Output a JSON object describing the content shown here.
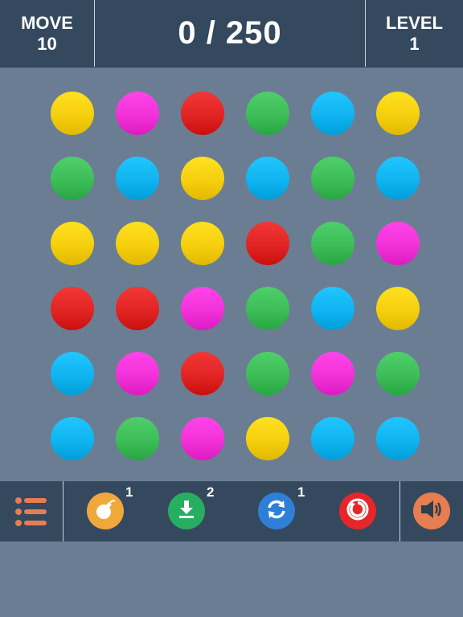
{
  "header": {
    "move_label": "MOVE",
    "move_value": "10",
    "score_text": "0 / 250",
    "level_label": "LEVEL",
    "level_value": "1"
  },
  "colors": {
    "yellow": "#f6cf0e",
    "magenta": "#f232d8",
    "red": "#e12424",
    "green": "#3dbd58",
    "blue": "#0fb4f0"
  },
  "board": {
    "rows": [
      [
        "yellow",
        "magenta",
        "red",
        "green",
        "blue",
        "yellow"
      ],
      [
        "green",
        "blue",
        "yellow",
        "blue",
        "green",
        "blue"
      ],
      [
        "yellow",
        "yellow",
        "yellow",
        "red",
        "green",
        "magenta"
      ],
      [
        "red",
        "red",
        "magenta",
        "green",
        "blue",
        "yellow"
      ],
      [
        "blue",
        "magenta",
        "red",
        "green",
        "magenta",
        "green"
      ],
      [
        "blue",
        "green",
        "magenta",
        "yellow",
        "blue",
        "blue"
      ]
    ]
  },
  "toolbar": {
    "menu_icon": "list-menu-icon",
    "bomb": {
      "icon": "bomb-icon",
      "count": "1",
      "color": "#f1a83a"
    },
    "drop": {
      "icon": "download-icon",
      "count": "2",
      "color": "#27ae60"
    },
    "shuffle": {
      "icon": "refresh-icon",
      "count": "1",
      "color": "#2f7fd6"
    },
    "restart": {
      "icon": "restart-icon",
      "color": "#e6262b"
    },
    "sound": {
      "icon": "speaker-icon",
      "color": "#e67e52"
    }
  }
}
